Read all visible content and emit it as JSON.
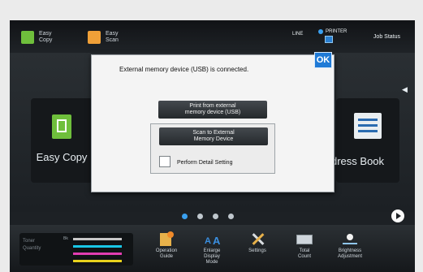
{
  "topbar": {
    "shortcuts": [
      {
        "label": "Easy\nCopy",
        "icon": "easy-copy-icon",
        "color": "#6fbf3c"
      },
      {
        "label": "Easy\nScan",
        "icon": "easy-scan-icon",
        "color": "#f0a038"
      }
    ],
    "line_label": "LINE",
    "printer_label": "PRINTER",
    "job_status": "Job Status"
  },
  "home": {
    "tiles": [
      {
        "label": "Easy\nCopy",
        "icon": "copy-icon",
        "color": "#6fbf3c"
      },
      {
        "label": "dress Book",
        "icon": "address-book-icon",
        "color": "#e9eef1"
      }
    ],
    "pages": [
      true,
      false,
      false,
      false
    ]
  },
  "dialog": {
    "message": "External memory device (USB) is connected.",
    "ok_label": "OK",
    "print_button": "Print from external\nmemory device (USB)",
    "scan_button": "Scan to External\nMemory Device",
    "detail_label": "Perform Detail Setting"
  },
  "bottom": {
    "toner": [
      {
        "label": "Toner",
        "color": "#c7c7c7"
      },
      {
        "label": "Quantity",
        "color": "#19c7e6"
      },
      {
        "label": "",
        "color": "#e23db1"
      },
      {
        "label": "",
        "color": "#e8d21d"
      }
    ],
    "toner_bk": "Bk",
    "buttons": [
      {
        "label": "Operation\nGuide",
        "icon": "operation-guide-icon"
      },
      {
        "label": "Enlarge\nDisplay\nMode",
        "icon": "enlarge-display-icon"
      },
      {
        "label": "Settings",
        "icon": "settings-icon"
      },
      {
        "label": "Total\nCount",
        "icon": "total-count-icon"
      },
      {
        "label": "Brightness\nAdjustment",
        "icon": "brightness-icon"
      }
    ]
  },
  "accent": "#1f7ad6"
}
